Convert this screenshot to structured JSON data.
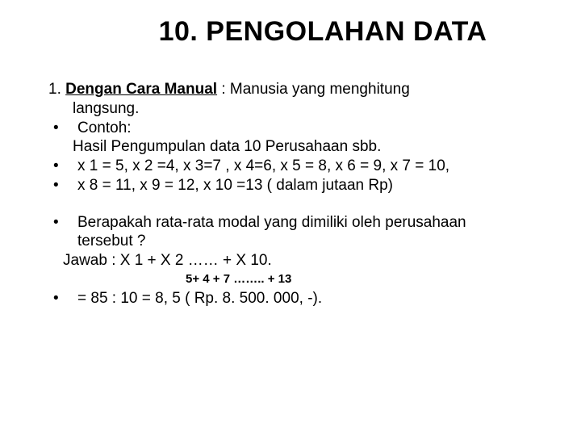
{
  "title": "10. PENGOLAHAN DATA",
  "p1_num": "1. ",
  "p1_lead": "Dengan Cara Manual",
  "p1_rest": " : Manusia  yang menghitung",
  "p1_cont": "langsung.",
  "b1": "Contoh:",
  "b1b": "Hasil Pengumpulan data 10 Perusahaan sbb.",
  "b2": "x 1 = 5, x 2 =4, x 3=7 , x 4=6, x 5 = 8, x 6 = 9, x 7 = 10,",
  "b3": "x 8 = 11, x 9 = 12, x 10 =13 ( dalam jutaan Rp)",
  "b4a": "Berapakah rata-rata modal yang dimiliki oleh perusahaan",
  "b4b": "tersebut ?",
  "b4c": "Jawab : X 1 + X 2 …… + X 10.",
  "small": "5+ 4  + 7 …….. + 13",
  "b5": "= 85 : 10 = 8, 5 ( Rp. 8. 500. 000, -)."
}
